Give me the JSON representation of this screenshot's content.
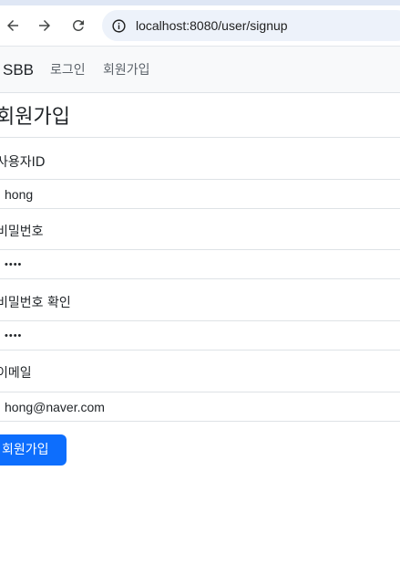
{
  "browser": {
    "url": "localhost:8080/user/signup",
    "back_icon": "arrow-left",
    "forward_icon": "arrow-right",
    "reload_icon": "reload",
    "site_info_icon": "info-circle"
  },
  "navbar": {
    "brand": "SBB",
    "links": [
      {
        "label": "로그인"
      },
      {
        "label": "회원가입"
      }
    ]
  },
  "page": {
    "title": "회원가입"
  },
  "form": {
    "username": {
      "label": "사용자ID",
      "value": "hong"
    },
    "password1": {
      "label": "비밀번호",
      "value": "••••"
    },
    "password2": {
      "label": "비밀번호 확인",
      "value": "••••"
    },
    "email": {
      "label": "이메일",
      "value": "hong@naver.com"
    },
    "submit_label": "회원가입"
  },
  "colors": {
    "primary": "#0d6efd",
    "navbar_bg": "#f8f9fa",
    "omnibox_bg": "#edf2fa"
  }
}
